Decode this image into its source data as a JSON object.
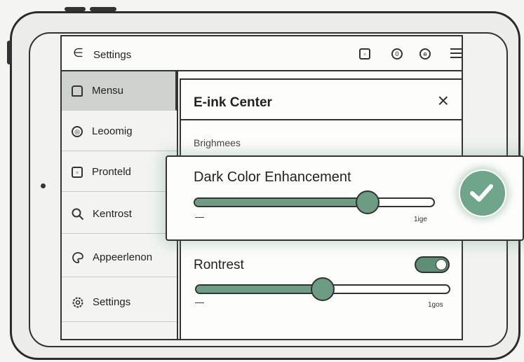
{
  "header": {
    "back_glyph": "∈",
    "title": "Settings",
    "icons": [
      "tablet-icon",
      "info-icon",
      "clock-icon",
      "menu-icon"
    ]
  },
  "sidebar": {
    "items": [
      {
        "label": "Mensu",
        "icon": "home-icon",
        "active": true
      },
      {
        "label": "Leoomig",
        "icon": "circle-icon",
        "active": false
      },
      {
        "label": "Pronteld",
        "icon": "square-icon",
        "active": false
      },
      {
        "label": "Kentrost",
        "icon": "search-icon",
        "active": false
      },
      {
        "label": "Appeerlenon",
        "icon": "palette-icon",
        "active": false
      },
      {
        "label": "Settings",
        "icon": "gear-icon",
        "active": false
      }
    ]
  },
  "panel": {
    "title": "E-ink Center",
    "section_label": "Brighmees",
    "contrast": {
      "label": "Rontrest",
      "toggle_on": true,
      "slider_value": 0.5,
      "min_label": "—",
      "max_label": "1gos"
    }
  },
  "card": {
    "title": "Dark Color Enhancement",
    "slider_value": 0.72,
    "min_label": "—",
    "max_label": "1ige"
  },
  "colors": {
    "accent": "#6fa58a",
    "accent_dark": "#5c8f76",
    "frame": "#2b2b2b"
  }
}
